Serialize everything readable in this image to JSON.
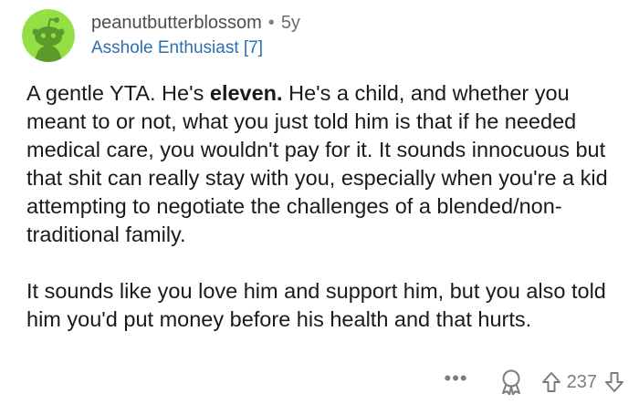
{
  "comment": {
    "username": "peanutbutterblossom",
    "separator": "•",
    "age": "5y",
    "flair": "Asshole Enthusiast [7]",
    "paragraph1": {
      "before_bold": "A gentle YTA. He's ",
      "bold": "eleven.",
      "after_bold": " He's a child, and whether you meant to or not, what you just told him is that if he needed medical care, you wouldn't pay for it. It sounds innocuous but that shit can really stay with you, especially when you're a kid attempting to negotiate the challenges of a blended/non-traditional family."
    },
    "paragraph2": "It sounds like you love him and support him, but you also told him you'd put money before his health and that hurts."
  },
  "footer": {
    "more_label": "•••",
    "vote_count": "237"
  },
  "icons": {
    "avatar": "reddit-snoo-avatar",
    "more": "more-options-icon",
    "award": "award-icon",
    "upvote": "upvote-arrow-icon",
    "downvote": "downvote-arrow-icon"
  },
  "colors": {
    "avatar_bg": "#94E044",
    "flair": "#2E6FB0",
    "meta_text": "#56595C",
    "icon_gray": "#7C7C7C",
    "body_text": "#1A1A1B"
  }
}
